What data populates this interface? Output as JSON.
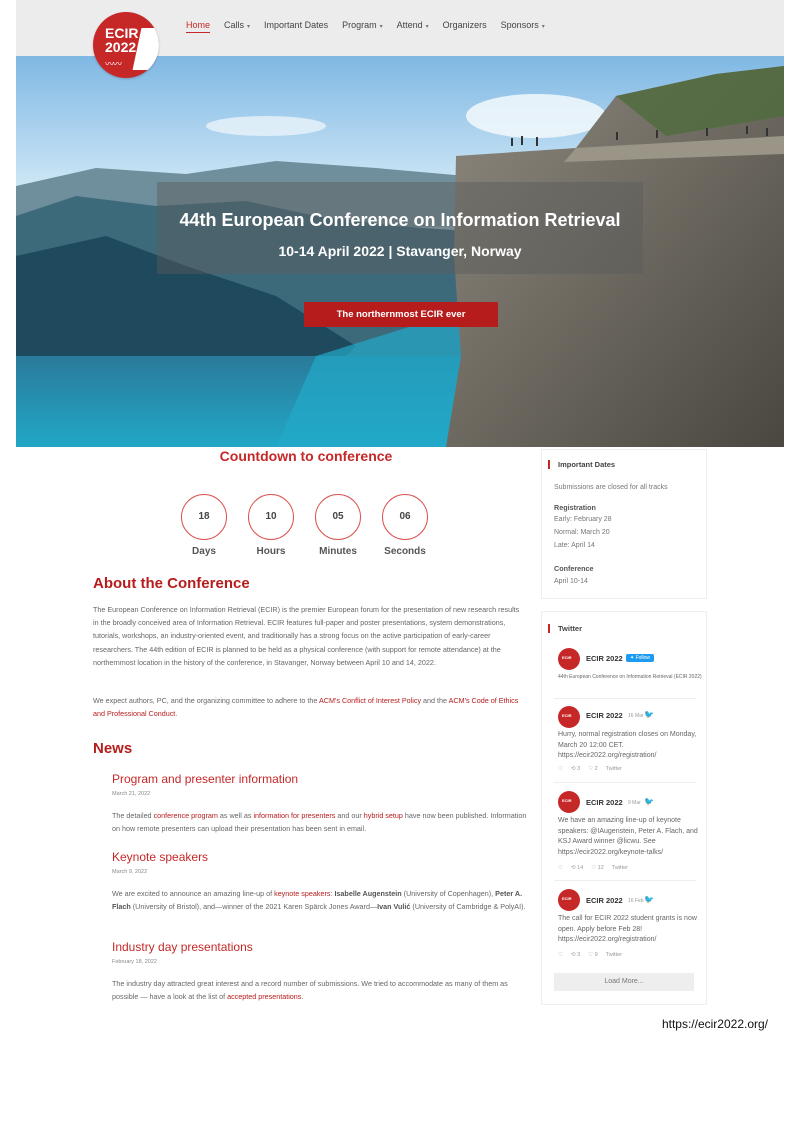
{
  "header": {
    "logo_lines": [
      "ECIR",
      "2022"
    ],
    "nav": [
      {
        "label": "Home",
        "active": true,
        "dropdown": false
      },
      {
        "label": "Calls",
        "active": false,
        "dropdown": true
      },
      {
        "label": "Important Dates",
        "active": false,
        "dropdown": false
      },
      {
        "label": "Program",
        "active": false,
        "dropdown": true
      },
      {
        "label": "Attend",
        "active": false,
        "dropdown": true
      },
      {
        "label": "Organizers",
        "active": false,
        "dropdown": false
      },
      {
        "label": "Sponsors",
        "active": false,
        "dropdown": true
      }
    ]
  },
  "hero": {
    "title": "44th European Conference on Information Retrieval",
    "subtitle": "10-14 April 2022 | Stavanger, Norway",
    "button": "The northernmost ECIR ever"
  },
  "countdown": {
    "title": "Countdown to conference",
    "items": [
      {
        "value": "18",
        "label": "Days"
      },
      {
        "value": "10",
        "label": "Hours"
      },
      {
        "value": "05",
        "label": "Minutes"
      },
      {
        "value": "06",
        "label": "Seconds"
      }
    ]
  },
  "about": {
    "title": "About the Conference",
    "p1": "The European Conference on Information Retrieval (ECIR) is the premier European forum for the presentation of new research results in the broadly conceived area of Information Retrieval. ECIR features full-paper and poster presentations, system demonstrations, tutorials, workshops, an industry-oriented event, and traditionally has a strong focus on the active participation of early-career researchers. The 44th edition of ECIR is planned to be held as a physical conference (with support for remote attendance) at the northernmost location in the history of the conference, in Stavanger, Norway between April 10 and 14, 2022.",
    "p2_before": "We expect authors, PC, and the organizing committee to adhere to the ",
    "p2_link1": "ACM's Conflict of Interest Policy",
    "p2_mid": " and the ",
    "p2_link2": "ACM's Code of Ethics and Professional Conduct",
    "p2_end": "."
  },
  "news": {
    "title": "News",
    "items": [
      {
        "title": "Program and presenter information",
        "date": "March 21, 2022",
        "t1": "The detailed ",
        "l1": "conference program",
        "t2": " as well as ",
        "l2": "information for presenters",
        "t3": " and our ",
        "l3": "hybrid setup",
        "t4": " have now been published. Information on how remote presenters can upload their presentation has been sent in email."
      },
      {
        "title": "Keynote speakers",
        "date": "March 9, 2022",
        "t1": "We are excited to announce an amazing line-up of ",
        "l1": "keynote speakers",
        "t2": ": ",
        "b1": "Isabelle Augenstein",
        "t3": " (University of Copenhagen), ",
        "b2": "Peter A. Flach",
        "t4": " (University of Bristol), and—winner of the 2021 Karen Spärck Jones Award—",
        "b3": "Ivan Vulić",
        "t5": " (University of Cambridge & PolyAI)."
      },
      {
        "title": "Industry day presentations",
        "date": "February 18, 2022",
        "t1": "The industry day attracted great interest and a record number of submissions. We tried to accommodate as many of them as possible — have a look at the list of ",
        "l1": "accepted presentations",
        "t2": "."
      }
    ]
  },
  "important_dates": {
    "title": "Important Dates",
    "note": "Submissions are closed for all tracks",
    "registration_label": "Registration",
    "early": "Early: February 28",
    "normal": "Normal: March 20",
    "late": "Late: April 14",
    "conference_label": "Conference",
    "conference_dates": "April 10-14"
  },
  "twitter": {
    "title": "Twitter",
    "profile_name": "ECIR 2022",
    "follow": "Follow",
    "profile_desc": "44th European Conference on Information Retrieval (ECIR 2022)",
    "tweets": [
      {
        "name": "ECIR 2022",
        "date": "16 Mar",
        "text": "Hurry, normal registration closes on Monday, March 20 12:00 CET. https://ecir2022.org/registration/",
        "retweets": "3",
        "likes": "2",
        "source": "Twitter"
      },
      {
        "name": "ECIR 2022",
        "date": "9 Mar",
        "text": "We have an amazing line-up of keynote speakers: @IAugenstein, Peter A. Flach, and KSJ Award winner @licwu. See https://ecir2022.org/keynote-talks/",
        "retweets": "14",
        "likes": "12",
        "source": "Twitter"
      },
      {
        "name": "ECIR 2022",
        "date": "16 Feb",
        "text": "The call for ECIR 2022 student grants is now open. Apply before Feb 28! https://ecir2022.org/registration/",
        "retweets": "3",
        "likes": "9",
        "source": "Twitter"
      }
    ],
    "avatar_text": "ECIR",
    "load_more": "Load More..."
  },
  "footer_url": "https://ecir2022.org/"
}
